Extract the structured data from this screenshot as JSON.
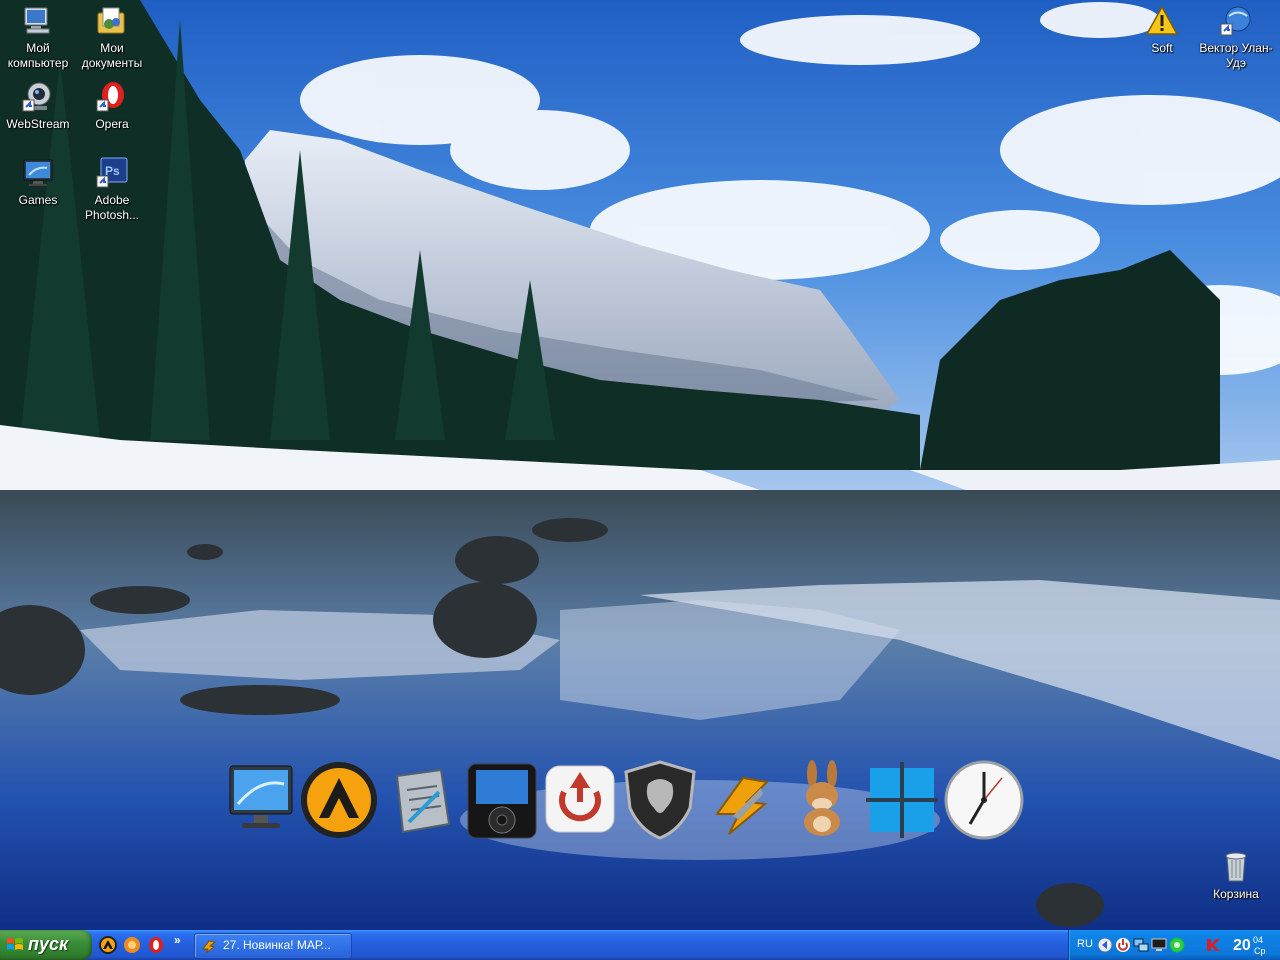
{
  "desktop": {
    "icons": [
      {
        "label": "Мой компьютер",
        "icon": "computer-icon"
      },
      {
        "label": "Мои документы",
        "icon": "documents-folder-icon"
      },
      {
        "label": "WebStream",
        "icon": "webcam-icon"
      },
      {
        "label": "Opera",
        "icon": "opera-icon"
      },
      {
        "label": "Games",
        "icon": "monitor-icon"
      },
      {
        "label": "Adobe Photosh...",
        "icon": "photoshop-icon"
      },
      {
        "label": "Soft",
        "icon": "warning-icon"
      },
      {
        "label": "Вектор Улан-Удэ",
        "icon": "shortcut-globe-icon"
      },
      {
        "label": "Корзина",
        "icon": "recycle-bin-icon"
      }
    ]
  },
  "dock": {
    "items": [
      {
        "icon": "monitor-icon"
      },
      {
        "icon": "aimp-player-icon"
      },
      {
        "icon": "notepad-icon"
      },
      {
        "icon": "ipod-player-icon"
      },
      {
        "icon": "power-restart-icon"
      },
      {
        "icon": "shield-dragon-icon"
      },
      {
        "icon": "winamp-lightning-icon"
      },
      {
        "icon": "emule-donkey-icon"
      },
      {
        "icon": "windows-logo-icon"
      },
      {
        "icon": "clock-icon"
      }
    ]
  },
  "taskbar": {
    "start_label": "пуск",
    "quicklaunch_more": "»",
    "task_label": "27. Новинка! МАР...",
    "tray": {
      "lang": "RU",
      "clock_hour": "20",
      "clock_minute": "04",
      "clock_day": "Ср"
    }
  },
  "colors": {
    "taskbar_blue": "#245edb",
    "start_green": "#3c8f3a",
    "tray_blue": "#0f82e6"
  }
}
